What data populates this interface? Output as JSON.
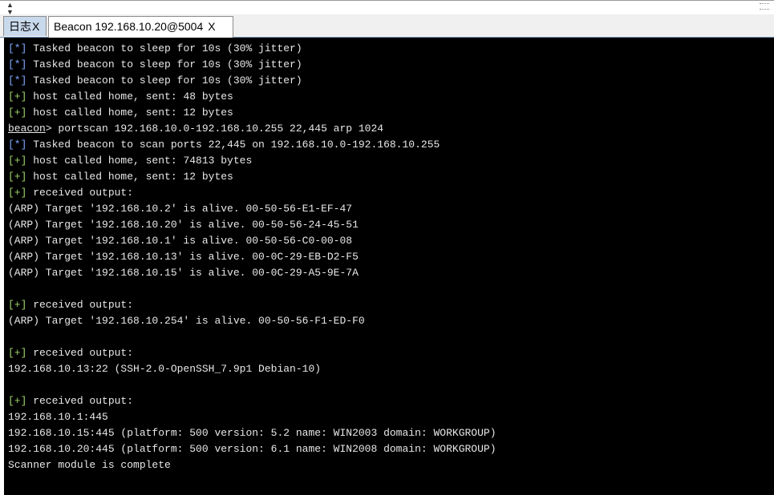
{
  "tabs": [
    {
      "label": "日志",
      "close": "X"
    },
    {
      "label": "Beacon 192.168.10.20@5004",
      "close": "X"
    }
  ],
  "terminal": {
    "lines": [
      {
        "tag": "[*]",
        "kind": "info",
        "text": " Tasked beacon to sleep for 10s (30% jitter)"
      },
      {
        "tag": "[*]",
        "kind": "info",
        "text": " Tasked beacon to sleep for 10s (30% jitter)"
      },
      {
        "tag": "[*]",
        "kind": "info",
        "text": " Tasked beacon to sleep for 10s (30% jitter)"
      },
      {
        "tag": "[+]",
        "kind": "ok",
        "text": " host called home, sent: 48 bytes"
      },
      {
        "tag": "[+]",
        "kind": "ok",
        "text": " host called home, sent: 12 bytes"
      },
      {
        "tag": "beacon",
        "kind": "prompt",
        "text": "> portscan 192.168.10.0-192.168.10.255 22,445 arp 1024"
      },
      {
        "tag": "[*]",
        "kind": "info",
        "text": " Tasked beacon to scan ports 22,445 on 192.168.10.0-192.168.10.255"
      },
      {
        "tag": "[+]",
        "kind": "ok",
        "text": " host called home, sent: 74813 bytes"
      },
      {
        "tag": "[+]",
        "kind": "ok",
        "text": " host called home, sent: 12 bytes"
      },
      {
        "tag": "[+]",
        "kind": "ok",
        "text": " received output:"
      },
      {
        "tag": "",
        "kind": "plain",
        "text": "(ARP) Target '192.168.10.2' is alive. 00-50-56-E1-EF-47"
      },
      {
        "tag": "",
        "kind": "plain",
        "text": "(ARP) Target '192.168.10.20' is alive. 00-50-56-24-45-51"
      },
      {
        "tag": "",
        "kind": "plain",
        "text": "(ARP) Target '192.168.10.1' is alive. 00-50-56-C0-00-08"
      },
      {
        "tag": "",
        "kind": "plain",
        "text": "(ARP) Target '192.168.10.13' is alive. 00-0C-29-EB-D2-F5"
      },
      {
        "tag": "",
        "kind": "plain",
        "text": "(ARP) Target '192.168.10.15' is alive. 00-0C-29-A5-9E-7A"
      },
      {
        "tag": "",
        "kind": "plain",
        "text": ""
      },
      {
        "tag": "[+]",
        "kind": "ok",
        "text": " received output:"
      },
      {
        "tag": "",
        "kind": "plain",
        "text": "(ARP) Target '192.168.10.254' is alive. 00-50-56-F1-ED-F0"
      },
      {
        "tag": "",
        "kind": "plain",
        "text": ""
      },
      {
        "tag": "[+]",
        "kind": "ok",
        "text": " received output:"
      },
      {
        "tag": "",
        "kind": "plain",
        "text": "192.168.10.13:22 (SSH-2.0-OpenSSH_7.9p1 Debian-10)"
      },
      {
        "tag": "",
        "kind": "plain",
        "text": ""
      },
      {
        "tag": "[+]",
        "kind": "ok",
        "text": " received output:"
      },
      {
        "tag": "",
        "kind": "plain",
        "text": "192.168.10.1:445"
      },
      {
        "tag": "",
        "kind": "plain",
        "text": "192.168.10.15:445 (platform: 500 version: 5.2 name: WIN2003 domain: WORKGROUP)"
      },
      {
        "tag": "",
        "kind": "plain",
        "text": "192.168.10.20:445 (platform: 500 version: 6.1 name: WIN2008 domain: WORKGROUP)"
      },
      {
        "tag": "",
        "kind": "plain",
        "text": "Scanner module is complete"
      }
    ]
  },
  "colors": {
    "info_tag": "#7fa7ff",
    "ok_tag": "#9ed36a",
    "terminal_bg": "#000000",
    "terminal_fg": "#e8e8e8"
  }
}
